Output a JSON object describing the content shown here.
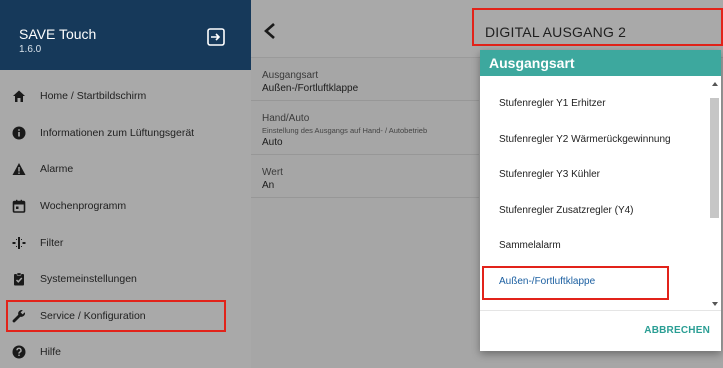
{
  "app": {
    "title": "SAVE Touch",
    "version": "1.6.0"
  },
  "sidebar": {
    "items": [
      {
        "label": "Home / Startbildschirm",
        "icon": "home-icon"
      },
      {
        "label": "Informationen zum Lüftungsgerät",
        "icon": "info-icon"
      },
      {
        "label": "Alarme",
        "icon": "warning-icon"
      },
      {
        "label": "Wochenprogramm",
        "icon": "calendar-icon"
      },
      {
        "label": "Filter",
        "icon": "filter-icon"
      },
      {
        "label": "Systemeinstellungen",
        "icon": "clipboard-check-icon"
      },
      {
        "label": "Service / Konfiguration",
        "icon": "wrench-icon"
      },
      {
        "label": "Hilfe",
        "icon": "help-icon"
      }
    ]
  },
  "main": {
    "heading": "DIGITAL AUSGANG 2",
    "params": [
      {
        "label": "Ausgangsart",
        "subtitle": "",
        "value": "Außen-/Fortluftklappe"
      },
      {
        "label": "Hand/Auto",
        "subtitle": "Einstellung des Ausgangs auf Hand- / Autobetrieb",
        "value": "Auto"
      },
      {
        "label": "Wert",
        "subtitle": "",
        "value": "An"
      }
    ]
  },
  "dialog": {
    "title": "Ausgangsart",
    "options": [
      "Stufenregler Y1 Erhitzer",
      "Stufenregler Y2 Wärmerückgewinnung",
      "Stufenregler Y3 Kühler",
      "Stufenregler Zusatzregler (Y4)",
      "Sammelalarm",
      "Außen-/Fortluftklappe"
    ],
    "selected": "Außen-/Fortluftklappe",
    "cancel_label": "ABBRECHEN"
  },
  "colors": {
    "header": "#16395a",
    "accent": "#3da89e",
    "highlight": "#e2231a",
    "link": "#1b5fa1"
  }
}
